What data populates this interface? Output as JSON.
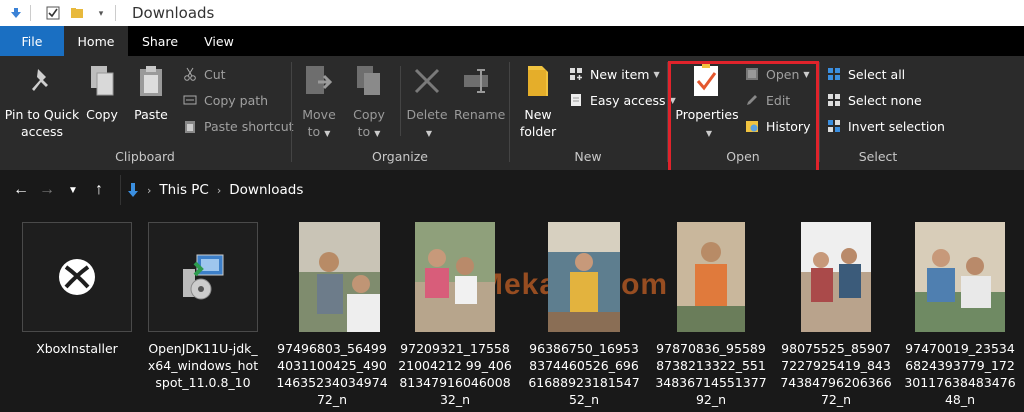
{
  "window": {
    "title": "Downloads"
  },
  "tabs": [
    {
      "label": "File"
    },
    {
      "label": "Home"
    },
    {
      "label": "Share"
    },
    {
      "label": "View"
    }
  ],
  "ribbon": {
    "clipboard": {
      "label": "Clipboard",
      "pin_line1": "Pin to Quick",
      "pin_line2": "access",
      "copy": "Copy",
      "paste": "Paste",
      "cut": "Cut",
      "copy_path": "Copy path",
      "paste_shortcut": "Paste shortcut"
    },
    "organize": {
      "label": "Organize",
      "move_to_1": "Move",
      "move_to_2": "to",
      "copy_to_1": "Copy",
      "copy_to_2": "to",
      "delete": "Delete",
      "rename": "Rename"
    },
    "new": {
      "label": "New",
      "new_folder_1": "New",
      "new_folder_2": "folder",
      "new_item": "New item",
      "easy_access": "Easy access"
    },
    "open": {
      "label": "Open",
      "properties": "Properties",
      "open": "Open",
      "edit": "Edit",
      "history": "History"
    },
    "select": {
      "label": "Select",
      "select_all": "Select all",
      "select_none": "Select none",
      "invert_selection": "Invert selection"
    }
  },
  "address": {
    "crumbs": [
      "This PC",
      "Downloads"
    ]
  },
  "watermark": "Mekan0.com",
  "files": [
    {
      "name": "XboxInstaller",
      "kind": "app-icon"
    },
    {
      "name": "OpenJDK11U-jdk_x64_windows_hotspot_11.0.8_10",
      "kind": "installer-icon"
    },
    {
      "name": "97496803_564994031100425_49014635234034974 72_n",
      "kind": "photo"
    },
    {
      "name": "97209321_1755821004212 99_40681347916046008 32_n",
      "kind": "photo"
    },
    {
      "name": "96386750_169538374460526_69661688923181547 52_n",
      "kind": "photo"
    },
    {
      "name": "97870836_955898738213322_55134836714551377 92_n",
      "kind": "photo"
    },
    {
      "name": "98075525_859077227925419_84374384796206366 72_n",
      "kind": "photo"
    },
    {
      "name": "97470019_235346824393779_17230117638483476 48_n",
      "kind": "photo"
    }
  ],
  "colors": {
    "accent": "#1a6fc2",
    "highlight": "#e0232b",
    "ribbon_bg": "#2b2b2b",
    "body_bg": "#191919"
  }
}
